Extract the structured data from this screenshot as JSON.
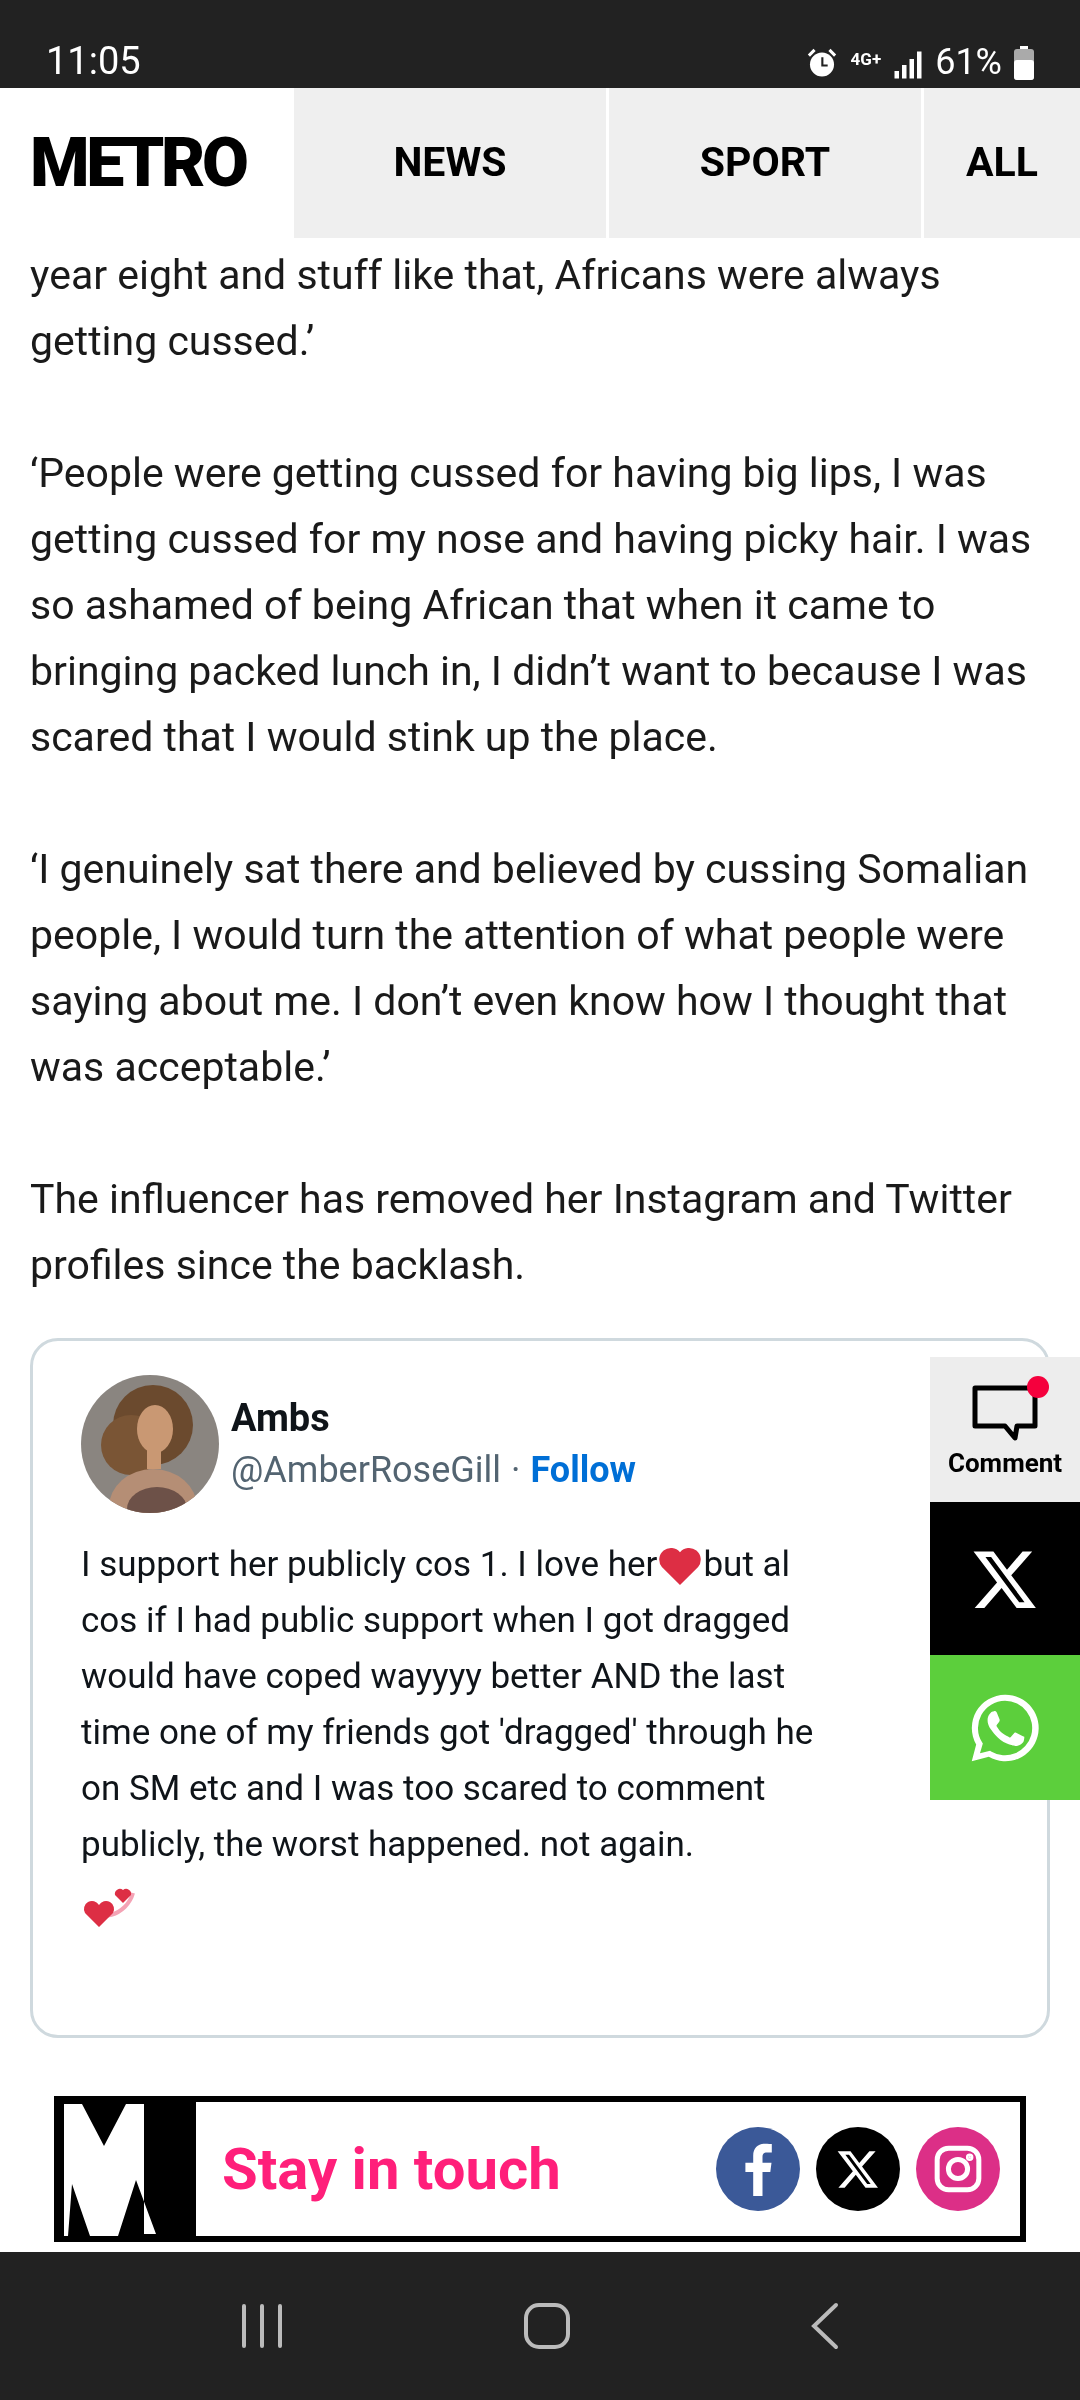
{
  "status_bar": {
    "time": "11:05",
    "network": "4G+",
    "battery": "61%"
  },
  "header": {
    "logo": "METRO",
    "tabs": [
      {
        "label": "NEWS"
      },
      {
        "label": "SPORT"
      },
      {
        "label": "ALL"
      }
    ]
  },
  "article": {
    "paragraphs": [
      "year eight and stuff like that, Africans were always getting cussed.’",
      "‘People were getting cussed for having big lips, I was getting cussed for my nose and having picky hair. I was so ashamed of being African that when it came to bringing packed lunch in, I didn’t want to because I was scared that I would stink up the place.",
      "‘I genuinely sat there and believed by cussing Somalian people, I would turn the attention of what people were saying about me. I don’t even know how I thought that was acceptable.’",
      "The influencer has removed her Instagram and Twitter profiles since the backlash."
    ]
  },
  "embedded_post": {
    "name": "Ambs",
    "handle": "@AmberRoseGill",
    "separator": "·",
    "follow": "Follow",
    "lines": [
      {
        "text": "I support her publicly cos 1. I love her",
        "rest": "but al"
      },
      {
        "text": "cos if I had public support when I got dragged"
      },
      {
        "text": "would have coped wayyyy better AND the last"
      },
      {
        "text": "time one of my friends got 'dragged' through he"
      },
      {
        "text": "on SM etc and I was too scared to comment"
      },
      {
        "text": "publicly, the worst happened. not again."
      }
    ]
  },
  "share_rail": {
    "buttons": [
      {
        "kind": "comment",
        "label": "Comment",
        "unread": true
      },
      {
        "kind": "x"
      },
      {
        "kind": "whatsapp"
      }
    ]
  },
  "banner": {
    "text": "Stay in touch",
    "socials": [
      {
        "kind": "facebook"
      },
      {
        "kind": "x"
      },
      {
        "kind": "instagram"
      }
    ]
  }
}
